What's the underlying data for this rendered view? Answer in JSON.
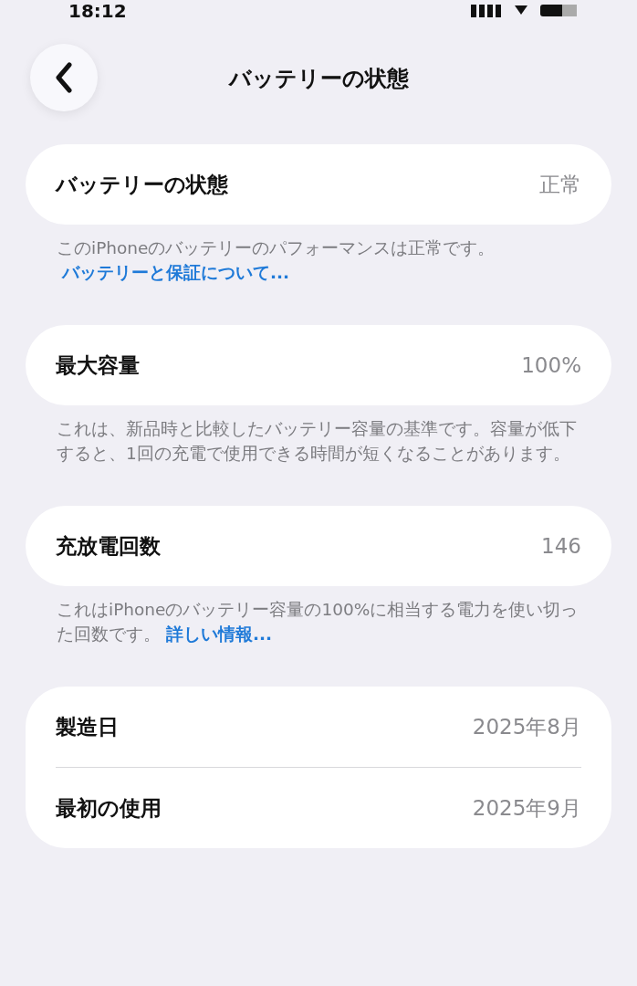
{
  "status_bar": {
    "time": "18:12"
  },
  "nav": {
    "title": "バッテリーの状態"
  },
  "sections": [
    {
      "rows": [
        {
          "label": "バッテリーの状態",
          "value": "正常"
        }
      ],
      "footer": {
        "text": "このiPhoneのバッテリーのパフォーマンスは正常です。",
        "link": "バッテリーと保証について..."
      }
    },
    {
      "rows": [
        {
          "label": "最大容量",
          "value": "100%"
        }
      ],
      "footer": {
        "text": "これは、新品時と比較したバッテリー容量の基準です。容量が低下すると、1回の充電で使用できる時間が短くなることがあります。"
      }
    },
    {
      "rows": [
        {
          "label": "充放電回数",
          "value": "146"
        }
      ],
      "footer": {
        "text": "これはiPhoneのバッテリー容量の100%に相当する電力を使い切った回数です。",
        "link": "詳しい情報..."
      }
    },
    {
      "rows": [
        {
          "label": "製造日",
          "value": "2025年8月"
        },
        {
          "label": "最初の使用",
          "value": "2025年9月"
        }
      ]
    }
  ]
}
